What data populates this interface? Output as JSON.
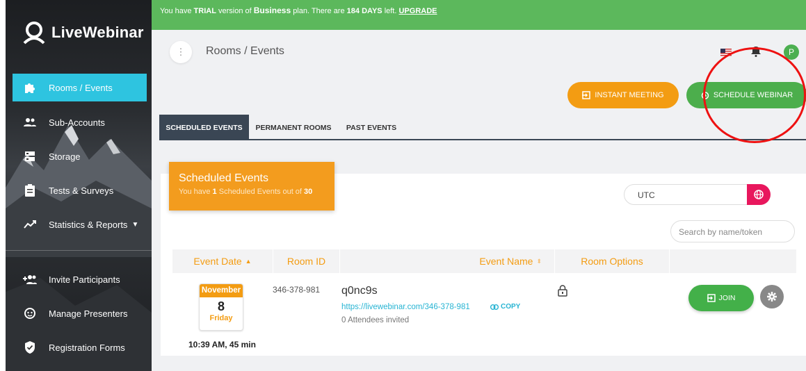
{
  "trial_bar": {
    "prefix": "You have",
    "trial": "TRIAL",
    "mid": "version of",
    "plan": "Business",
    "mid2": "plan. There are",
    "days": "184 DAYS",
    "suffix": "left.",
    "upgrade": "UPGRADE"
  },
  "brand": {
    "name": "LiveWebinar"
  },
  "sidebar": {
    "items": [
      {
        "label": "Rooms / Events",
        "icon": "puzzle-icon",
        "active": true
      },
      {
        "label": "Sub-Accounts",
        "icon": "users-icon"
      },
      {
        "label": "Storage",
        "icon": "storage-icon"
      },
      {
        "label": "Tests & Surveys",
        "icon": "clipboard-icon"
      },
      {
        "label": "Statistics & Reports",
        "icon": "chart-line-icon"
      },
      {
        "label": "Invite Participants",
        "icon": "add-users-icon"
      },
      {
        "label": "Manage Presenters",
        "icon": "presenter-icon"
      },
      {
        "label": "Registration Forms",
        "icon": "shield-check-icon"
      }
    ]
  },
  "header": {
    "breadcrumb": "Rooms / Events",
    "avatar_letter": "P",
    "instant_meeting": "INSTANT MEETING",
    "schedule_webinar": "SCHEDULE WEBINAR"
  },
  "tabs": [
    {
      "label": "SCHEDULED EVENTS",
      "active": true
    },
    {
      "label": "PERMANENT ROOMS"
    },
    {
      "label": "PAST EVENTS"
    }
  ],
  "scheduled_card": {
    "title": "Scheduled Events",
    "sub_prefix": "You have",
    "count": "1",
    "sub_mid": "Scheduled Events out of",
    "max": "30"
  },
  "timezone": {
    "value": "UTC"
  },
  "search": {
    "placeholder": "Search by name/token"
  },
  "table": {
    "columns": [
      "Event Date",
      "Room ID",
      "Event Name",
      "Room Options",
      ""
    ],
    "rows": [
      {
        "month": "November",
        "day": "8",
        "weekday": "Friday",
        "time": "10:39 AM, 45 min",
        "room_id": "346-378-981",
        "event_name": "q0nc9s",
        "url": "https://livewebinar.com/346-378-981",
        "copy": "COPY",
        "attendees": "0 Attendees invited",
        "join": "JOIN"
      }
    ]
  },
  "colors": {
    "trial_green": "#5cb85c",
    "accent_cyan": "#2ec4e0",
    "orange": "#f39c12",
    "green_button": "#4cae4c",
    "pink": "#e8175d",
    "tab_dark": "#3a4654",
    "annotation_red": "#ee1111"
  }
}
